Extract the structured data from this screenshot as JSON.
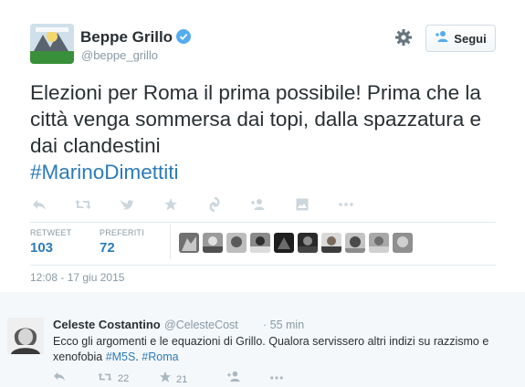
{
  "tweet": {
    "author_name": "Beppe Grillo",
    "author_handle": "@beppe_grillo",
    "follow_label": "Segui",
    "text_main": "Elezioni per Roma il prima possibile! Prima che la città venga sommersa dai topi, dalla spazzatura e dai clandestini",
    "hashtag": "#MarinoDimettiti",
    "retweet_label": "RETWEET",
    "retweet_count": "103",
    "favorites_label": "PREFERITI",
    "favorites_count": "72",
    "timestamp": "12:08 - 17 giu 2015",
    "icons": [
      "reply-icon",
      "retweet-icon",
      "favorite-icon",
      "vine-icon",
      "loop-icon",
      "follow-icon",
      "image-icon",
      "more-icon"
    ]
  },
  "reply": {
    "author_name": "Celeste Costantino",
    "author_handle": "@CelesteCost",
    "time": "· 55 min",
    "text_before": "Ecco gli argomenti e le equazioni di Grillo.  Qualora servissero altri indizi su razzismo e xenofobia ",
    "tag_m5s": "#M5S",
    "tag_roma": "#Roma",
    "retweet_count": "22",
    "favorite_count": "21"
  },
  "colors": {
    "link": "#2b7bb9",
    "muted": "#8899a6",
    "text": "#292f33",
    "verified": "#55acee"
  }
}
